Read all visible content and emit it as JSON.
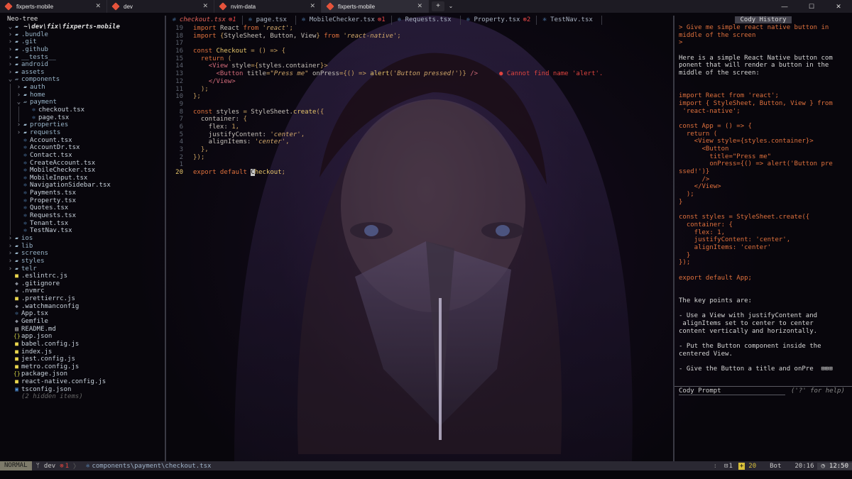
{
  "window_tabs": [
    {
      "label": "fixperts-mobile",
      "icon_color": "#e5533b",
      "active": false
    },
    {
      "label": "dev",
      "icon_color": "#e5533b",
      "active": false
    },
    {
      "label": "nvim-data",
      "icon_color": "#e5533b",
      "active": false
    },
    {
      "label": "fixperts-mobile",
      "icon_color": "#e5533b",
      "active": true
    }
  ],
  "window_controls": {
    "new_tab": "+",
    "dropdown": "⌄",
    "minimize": "—",
    "maximize": "☐",
    "close": "✕"
  },
  "tree": {
    "header": "Neo-tree",
    "root": "~\\dev\\fix\\fixperts-mobile",
    "items": [
      {
        "label": ".bundle",
        "depth": 1,
        "kind": "dir",
        "open": false
      },
      {
        "label": ".git",
        "depth": 1,
        "kind": "dir",
        "open": false
      },
      {
        "label": ".github",
        "depth": 1,
        "kind": "dir",
        "open": false
      },
      {
        "label": "__tests__",
        "depth": 1,
        "kind": "dir",
        "open": false
      },
      {
        "label": "android",
        "depth": 1,
        "kind": "dir",
        "open": false
      },
      {
        "label": "assets",
        "depth": 1,
        "kind": "dir",
        "open": false
      },
      {
        "label": "components",
        "depth": 1,
        "kind": "dir",
        "open": true
      },
      {
        "label": "auth",
        "depth": 2,
        "kind": "dir",
        "open": false
      },
      {
        "label": "home",
        "depth": 2,
        "kind": "dir",
        "open": false
      },
      {
        "label": "payment",
        "depth": 2,
        "kind": "dir",
        "open": true
      },
      {
        "label": "checkout.tsx",
        "depth": 3,
        "kind": "tsx"
      },
      {
        "label": "page.tsx",
        "depth": 3,
        "kind": "tsx"
      },
      {
        "label": "properties",
        "depth": 2,
        "kind": "dir",
        "open": false
      },
      {
        "label": "requests",
        "depth": 2,
        "kind": "dir",
        "open": false
      },
      {
        "label": "Account.tsx",
        "depth": 2,
        "kind": "tsx"
      },
      {
        "label": "AccountDr.tsx",
        "depth": 2,
        "kind": "tsx"
      },
      {
        "label": "Contact.tsx",
        "depth": 2,
        "kind": "tsx"
      },
      {
        "label": "CreateAccount.tsx",
        "depth": 2,
        "kind": "tsx"
      },
      {
        "label": "MobileChecker.tsx",
        "depth": 2,
        "kind": "tsx"
      },
      {
        "label": "MobileInput.tsx",
        "depth": 2,
        "kind": "tsx"
      },
      {
        "label": "NavigationSidebar.tsx",
        "depth": 2,
        "kind": "tsx"
      },
      {
        "label": "Payments.tsx",
        "depth": 2,
        "kind": "tsx"
      },
      {
        "label": "Property.tsx",
        "depth": 2,
        "kind": "tsx"
      },
      {
        "label": "Quotes.tsx",
        "depth": 2,
        "kind": "tsx"
      },
      {
        "label": "Requests.tsx",
        "depth": 2,
        "kind": "tsx"
      },
      {
        "label": "Tenant.tsx",
        "depth": 2,
        "kind": "tsx"
      },
      {
        "label": "TestNav.tsx",
        "depth": 2,
        "kind": "tsx"
      },
      {
        "label": "ios",
        "depth": 1,
        "kind": "dir",
        "open": false
      },
      {
        "label": "lib",
        "depth": 1,
        "kind": "dir",
        "open": false
      },
      {
        "label": "screens",
        "depth": 1,
        "kind": "dir",
        "open": false
      },
      {
        "label": "styles",
        "depth": 1,
        "kind": "dir",
        "open": false
      },
      {
        "label": "telr",
        "depth": 1,
        "kind": "dir",
        "open": false
      },
      {
        "label": ".eslintrc.js",
        "depth": 1,
        "kind": "js"
      },
      {
        "label": ".gitignore",
        "depth": 1,
        "kind": "dot"
      },
      {
        "label": ".nvmrc",
        "depth": 1,
        "kind": "dot"
      },
      {
        "label": ".prettierrc.js",
        "depth": 1,
        "kind": "js"
      },
      {
        "label": ".watchmanconfig",
        "depth": 1,
        "kind": "dot"
      },
      {
        "label": "App.tsx",
        "depth": 1,
        "kind": "tsx"
      },
      {
        "label": "Gemfile",
        "depth": 1,
        "kind": "dot"
      },
      {
        "label": "README.md",
        "depth": 1,
        "kind": "md"
      },
      {
        "label": "app.json",
        "depth": 1,
        "kind": "json"
      },
      {
        "label": "babel.config.js",
        "depth": 1,
        "kind": "js"
      },
      {
        "label": "index.js",
        "depth": 1,
        "kind": "js"
      },
      {
        "label": "jest.config.js",
        "depth": 1,
        "kind": "js"
      },
      {
        "label": "metro.config.js",
        "depth": 1,
        "kind": "js"
      },
      {
        "label": "package.json",
        "depth": 1,
        "kind": "json"
      },
      {
        "label": "react-native.config.js",
        "depth": 1,
        "kind": "js"
      },
      {
        "label": "tsconfig.json",
        "depth": 1,
        "kind": "ts"
      },
      {
        "label": "(2 hidden items)",
        "depth": 1,
        "kind": "hidden"
      }
    ]
  },
  "editor_tabs": [
    {
      "label": "checkout.tsx",
      "badge": "⊗1",
      "current": true
    },
    {
      "label": "page.tsx",
      "badge": "",
      "current": false
    },
    {
      "label": "MobileChecker.tsx",
      "badge": "⊗1",
      "current": false
    },
    {
      "label": "Requests.tsx",
      "badge": "",
      "current": false
    },
    {
      "label": "Property.tsx",
      "badge": "⊗2",
      "current": false
    },
    {
      "label": "TestNav.tsx",
      "badge": "",
      "current": false
    }
  ],
  "code_lines": [
    {
      "n": "19",
      "segs": [
        [
          "kw",
          "import "
        ],
        [
          "id",
          "React "
        ],
        [
          "kw",
          "from "
        ],
        [
          "str",
          "'react'"
        ],
        [
          "pu",
          ";"
        ]
      ]
    },
    {
      "n": "18",
      "segs": [
        [
          "kw",
          "import "
        ],
        [
          "pu",
          "{"
        ],
        [
          "id",
          "StyleSheet, Button, View"
        ],
        [
          "pu",
          "} "
        ],
        [
          "kw",
          "from "
        ],
        [
          "str",
          "'react-native'"
        ],
        [
          "pu",
          ";"
        ]
      ]
    },
    {
      "n": "17",
      "segs": []
    },
    {
      "n": "16",
      "segs": [
        [
          "kw",
          "const "
        ],
        [
          "fn",
          "Checkout "
        ],
        [
          "pu",
          "= () => {"
        ]
      ]
    },
    {
      "n": "15",
      "segs": [
        [
          "id",
          "  "
        ],
        [
          "kw",
          "return "
        ],
        [
          "pu",
          "("
        ]
      ]
    },
    {
      "n": "14",
      "segs": [
        [
          "id",
          "    "
        ],
        [
          "ty",
          "<View "
        ],
        [
          "id",
          "style"
        ],
        [
          "pu",
          "={"
        ],
        [
          "id",
          "styles.container"
        ],
        [
          "pu",
          "}>"
        ]
      ]
    },
    {
      "n": "13",
      "segs": [
        [
          "id",
          "      "
        ],
        [
          "ty",
          "<Button "
        ],
        [
          "id",
          "title"
        ],
        [
          "pu",
          "="
        ],
        [
          "str",
          "\"Press me\" "
        ],
        [
          "id",
          "onPress"
        ],
        [
          "pu",
          "={() => "
        ],
        [
          "fn",
          "alert"
        ],
        [
          "pu",
          "("
        ],
        [
          "str",
          "'Button pressed!'"
        ],
        [
          "pu",
          ")} "
        ],
        [
          "ty",
          "/>"
        ]
      ],
      "diag": "● Cannot find name 'alert'."
    },
    {
      "n": "12",
      "segs": [
        [
          "id",
          "    "
        ],
        [
          "ty",
          "</View>"
        ]
      ]
    },
    {
      "n": "11",
      "segs": [
        [
          "id",
          "  "
        ],
        [
          "pu",
          ");"
        ]
      ]
    },
    {
      "n": "10",
      "segs": [
        [
          "pu",
          "};"
        ]
      ]
    },
    {
      "n": "9",
      "segs": []
    },
    {
      "n": "8",
      "segs": [
        [
          "kw",
          "const "
        ],
        [
          "id",
          "styles "
        ],
        [
          "pu",
          "= "
        ],
        [
          "id",
          "StyleSheet."
        ],
        [
          "fn",
          "create"
        ],
        [
          "pu",
          "({"
        ]
      ]
    },
    {
      "n": "7",
      "segs": [
        [
          "id",
          "  container: "
        ],
        [
          "pu",
          "{"
        ]
      ]
    },
    {
      "n": "6",
      "segs": [
        [
          "id",
          "    flex: "
        ],
        [
          "pu",
          "1,"
        ]
      ]
    },
    {
      "n": "5",
      "segs": [
        [
          "id",
          "    justifyContent: "
        ],
        [
          "str",
          "'center'"
        ],
        [
          "pu",
          ","
        ]
      ]
    },
    {
      "n": "4",
      "segs": [
        [
          "id",
          "    alignItems: "
        ],
        [
          "str",
          "'center'"
        ],
        [
          "pu",
          ","
        ]
      ]
    },
    {
      "n": "3",
      "segs": [
        [
          "id",
          "  "
        ],
        [
          "pu",
          "},"
        ]
      ]
    },
    {
      "n": "2",
      "segs": [
        [
          "pu",
          "});"
        ]
      ]
    },
    {
      "n": "1",
      "segs": []
    },
    {
      "n": "20",
      "current": true,
      "segs": [
        [
          "kw",
          "export default "
        ],
        [
          "cursor",
          "C"
        ],
        [
          "fn",
          "heckout"
        ],
        [
          "pu",
          ";"
        ]
      ]
    }
  ],
  "cody": {
    "title": "Cody History",
    "lines": [
      {
        "t": "> Give me simple react native button in",
        "acc": true
      },
      {
        "t": "middle of the screen",
        "acc": true
      },
      {
        "t": ">",
        "acc": true
      },
      {
        "t": ""
      },
      {
        "t": "Here is a simple React Native button com"
      },
      {
        "t": "ponent that will render a button in the"
      },
      {
        "t": "middle of the screen:"
      },
      {
        "t": ""
      },
      {
        "t": ""
      },
      {
        "t": "import React from 'react';",
        "acc": true
      },
      {
        "t": "import { StyleSheet, Button, View } from",
        "acc": true
      },
      {
        "t": " 'react-native';",
        "acc": true
      },
      {
        "t": ""
      },
      {
        "t": "const App = () => {",
        "acc": true
      },
      {
        "t": "  return (",
        "acc": true
      },
      {
        "t": "    <View style={styles.container}>",
        "acc": true
      },
      {
        "t": "      <Button",
        "acc": true
      },
      {
        "t": "        title=\"Press me\"",
        "acc": true
      },
      {
        "t": "        onPress={() => alert('Button pre",
        "acc": true
      },
      {
        "t": "ssed!')}",
        "acc": true
      },
      {
        "t": "      />",
        "acc": true
      },
      {
        "t": "    </View>",
        "acc": true
      },
      {
        "t": "  );",
        "acc": true
      },
      {
        "t": "}",
        "acc": true
      },
      {
        "t": ""
      },
      {
        "t": "const styles = StyleSheet.create({",
        "acc": true
      },
      {
        "t": "  container: {",
        "acc": true
      },
      {
        "t": "    flex: 1,",
        "acc": true
      },
      {
        "t": "    justifyContent: 'center',",
        "acc": true
      },
      {
        "t": "    alignItems: 'center'",
        "acc": true
      },
      {
        "t": "  }",
        "acc": true
      },
      {
        "t": "});",
        "acc": true
      },
      {
        "t": ""
      },
      {
        "t": "export default App;",
        "acc": true
      },
      {
        "t": ""
      },
      {
        "t": ""
      },
      {
        "t": "The key points are:"
      },
      {
        "t": ""
      },
      {
        "t": "- Use a View with justifyContent and"
      },
      {
        "t": " alignItems set to center to center"
      },
      {
        "t": "content vertically and horizontally."
      },
      {
        "t": ""
      },
      {
        "t": "- Put the Button component inside the"
      },
      {
        "t": "centered View."
      },
      {
        "t": ""
      },
      {
        "t": "- Give the Button a title and onPre  ⊞⊞⊞"
      }
    ],
    "prompt_label": "Cody Prompt",
    "prompt_hint": "('?' for help)"
  },
  "status": {
    "mode": "NORMAL",
    "branch": "dev",
    "errors": "1",
    "path": "components\\payment\\checkout.tsx",
    "right_sep": ":",
    "diag_count": "1",
    "add_count": "20",
    "position": "Bot",
    "cursor_pos": "20:16",
    "clock": "12:50"
  },
  "colors": {
    "accent": "#e0713d",
    "error": "#e0443f",
    "tsx": "#6aa9e8",
    "dir": "#98b4c8"
  }
}
